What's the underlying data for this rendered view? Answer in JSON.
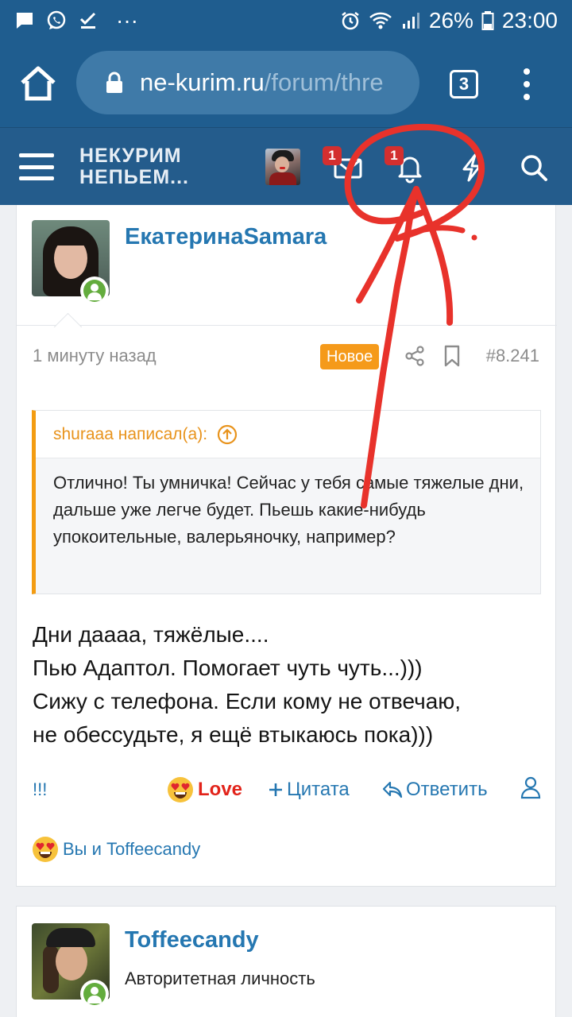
{
  "status_bar": {
    "battery": "26%",
    "time": "23:00",
    "dots": "···"
  },
  "browser": {
    "url_domain": "ne-kurim.ru",
    "url_path": "/forum/thre",
    "tab_count": "3"
  },
  "site_header": {
    "logo_line1": "НЕКУРИМ",
    "logo_line2": "НЕПЬЕМ...",
    "inbox_badge": "1",
    "alerts_badge": "1",
    "icons": [
      "menu-icon",
      "mail-icon",
      "bell-icon",
      "bolt-icon",
      "search-icon"
    ]
  },
  "post": {
    "username": "ЕкатеринаSamara",
    "time": "1 минуту назад",
    "new_label": "Новое",
    "post_number": "#8.241",
    "quote": {
      "author": "shuraaa написал(а):",
      "text": "Отлично! Ты умничка! Сейчас у тебя самые тяжелые дни, дальше уже легче будет. Пьешь какие-нибудь упокоительные, валерьяночку, например?"
    },
    "body_lines": [
      "Дни даааа, тяжёлые....",
      "Пью Адаптол. Помогает чуть чуть...)))",
      "Сижу с телефона. Если кому не отвечаю,",
      "не обессудьте, я ещё втыкаюсь пока)))"
    ],
    "actions": {
      "report": "!!!",
      "love": "Love",
      "quote": "Цитата",
      "reply": "Ответить"
    },
    "reactions_text": "Вы и Toffeecandy"
  },
  "next_post": {
    "username": "Toffeecandy",
    "user_title": "Авторитетная личность"
  },
  "colors": {
    "header_bg": "#245c8c",
    "status_bg": "#1f5d8f",
    "link": "#2577b1",
    "accent_orange": "#f39c12",
    "new_badge": "#f59a1a",
    "love_red": "#e2231a",
    "online_green": "#63ac3d",
    "annotation_red": "#e8322b"
  }
}
